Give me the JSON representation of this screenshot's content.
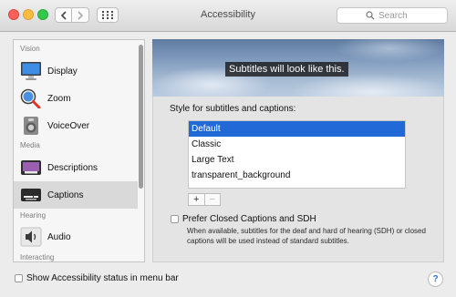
{
  "window": {
    "title": "Accessibility"
  },
  "toolbar": {
    "search_placeholder": "Search"
  },
  "sidebar": {
    "sections": [
      {
        "header": "Vision",
        "items": [
          {
            "label": "Display",
            "icon": "display-icon"
          },
          {
            "label": "Zoom",
            "icon": "zoom-icon"
          },
          {
            "label": "VoiceOver",
            "icon": "voiceover-icon"
          }
        ]
      },
      {
        "header": "Media",
        "items": [
          {
            "label": "Descriptions",
            "icon": "descriptions-icon"
          },
          {
            "label": "Captions",
            "icon": "captions-icon",
            "selected": true
          }
        ]
      },
      {
        "header": "Hearing",
        "items": [
          {
            "label": "Audio",
            "icon": "audio-icon"
          }
        ]
      },
      {
        "header": "Interacting",
        "items": []
      }
    ]
  },
  "captions": {
    "preview_text": "Subtitles will look like this.",
    "style_label": "Style for subtitles and captions:",
    "styles": [
      "Default",
      "Classic",
      "Large Text",
      "transparent_background"
    ],
    "selected_style": "Default",
    "add_label": "+",
    "remove_label": "−",
    "prefer_cc_label": "Prefer Closed Captions and SDH",
    "prefer_cc_checked": false,
    "prefer_cc_description": "When available, subtitles for the deaf and hard of hearing (SDH) or closed captions will be used instead of standard subtitles."
  },
  "footer": {
    "show_status_label": "Show Accessibility status in menu bar",
    "show_status_checked": false,
    "help_label": "?"
  },
  "colors": {
    "selection": "#2169d6",
    "close": "#fc605b",
    "minimize": "#fdbc40",
    "maximize": "#34c84a"
  }
}
